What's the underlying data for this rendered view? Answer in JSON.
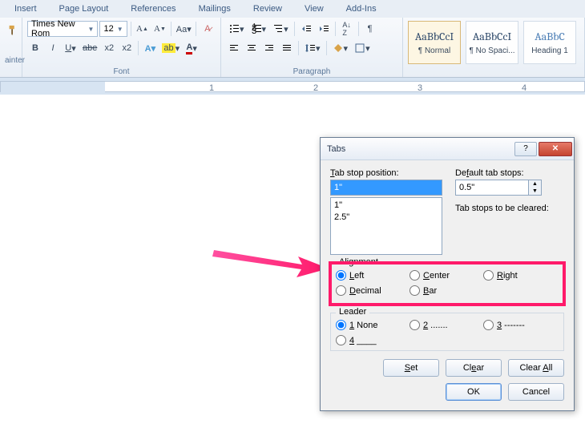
{
  "ribbon": {
    "tabs": [
      "Insert",
      "Page Layout",
      "References",
      "Mailings",
      "Review",
      "View",
      "Add-Ins"
    ],
    "font": {
      "name": "Times New Rom",
      "size": "12",
      "group_label": "Font"
    },
    "paragraph": {
      "group_label": "Paragraph"
    },
    "painter_label": "ainter",
    "styles": [
      {
        "preview": "AaBbCcI",
        "name": "¶ Normal"
      },
      {
        "preview": "AaBbCcI",
        "name": "¶ No Spaci..."
      },
      {
        "preview": "AaBbC",
        "name": "Heading 1"
      }
    ]
  },
  "dialog": {
    "title": "Tabs",
    "tab_stop_label": "Tab stop position:",
    "tab_stop_value": "1\"",
    "list": [
      "1\"",
      "2.5\""
    ],
    "default_label": "Default tab stops:",
    "default_value": "0.5\"",
    "cleared_label": "Tab stops to be cleared:",
    "alignment_legend": "Alignment",
    "alignment": {
      "left": "Left",
      "center": "Center",
      "right": "Right",
      "decimal": "Decimal",
      "bar": "Bar"
    },
    "leader_legend": "Leader",
    "leader": {
      "none": "1 None",
      "dots": "2 .......",
      "dashes": "3 -------",
      "under": "4 ____"
    },
    "buttons": {
      "set": "Set",
      "clear": "Clear",
      "clear_all": "Clear All",
      "ok": "OK",
      "cancel": "Cancel"
    }
  }
}
